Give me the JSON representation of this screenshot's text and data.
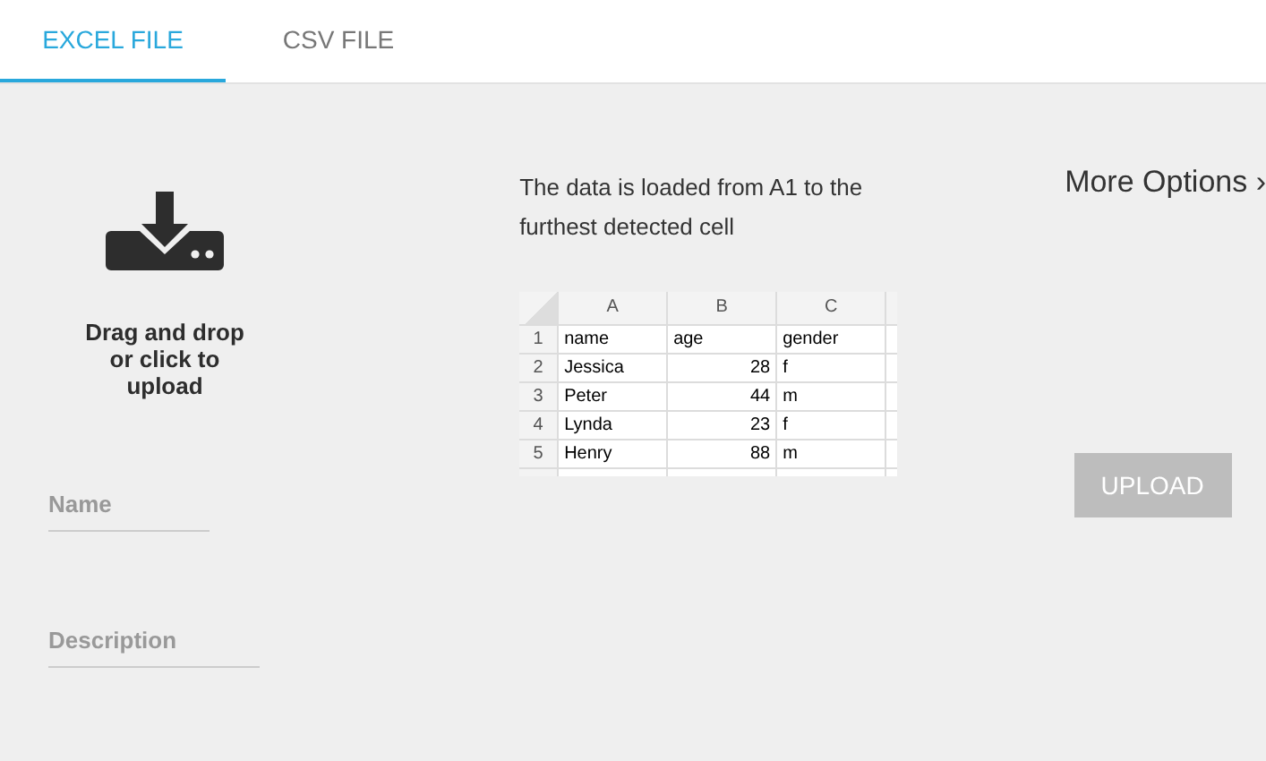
{
  "tabs": [
    {
      "label": "EXCEL FILE",
      "selected": true
    },
    {
      "label": "CSV FILE",
      "selected": false
    }
  ],
  "dropzone": {
    "text": "Drag and drop or click to upload"
  },
  "fields": [
    {
      "placeholder": "Name"
    },
    {
      "placeholder": "Description"
    }
  ],
  "info": "The data is loaded from A1 to the furthest detected cell",
  "sample_sheet": {
    "columns": [
      "A",
      "B",
      "C"
    ],
    "rows": [
      {
        "number": "1",
        "cells": [
          "name",
          "age",
          "gender"
        ]
      },
      {
        "number": "2",
        "cells": [
          "Jessica",
          "28",
          "f"
        ]
      },
      {
        "number": "3",
        "cells": [
          "Peter",
          "44",
          "m"
        ]
      },
      {
        "number": "4",
        "cells": [
          "Lynda",
          "23",
          "f"
        ]
      },
      {
        "number": "5",
        "cells": [
          "Henry",
          "88",
          "m"
        ]
      }
    ]
  },
  "more_options": {
    "label": "More Options",
    "chevron": "›"
  },
  "upload_button": {
    "label": "UPLOAD",
    "disabled": true
  }
}
